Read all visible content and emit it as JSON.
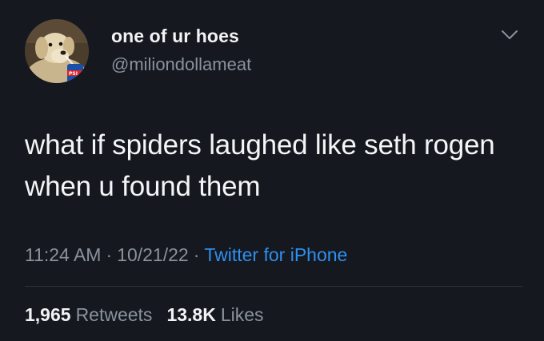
{
  "author": {
    "display_name": "one of ur hoes",
    "handle": "@miliondollameat",
    "avatar_icon": "dog-drinking-soda-avatar"
  },
  "tweet": {
    "text": "what if spiders laughed like seth rogen when u found them",
    "time": "11:24 AM",
    "date": "10/21/22",
    "separator": "·",
    "source": "Twitter for iPhone"
  },
  "stats": {
    "retweets_count": "1,965",
    "retweets_label": "Retweets",
    "likes_count": "13.8K",
    "likes_label": "Likes"
  },
  "colors": {
    "background": "#15181f",
    "accent": "#2f8ff0",
    "secondary_text": "#8a929c"
  }
}
